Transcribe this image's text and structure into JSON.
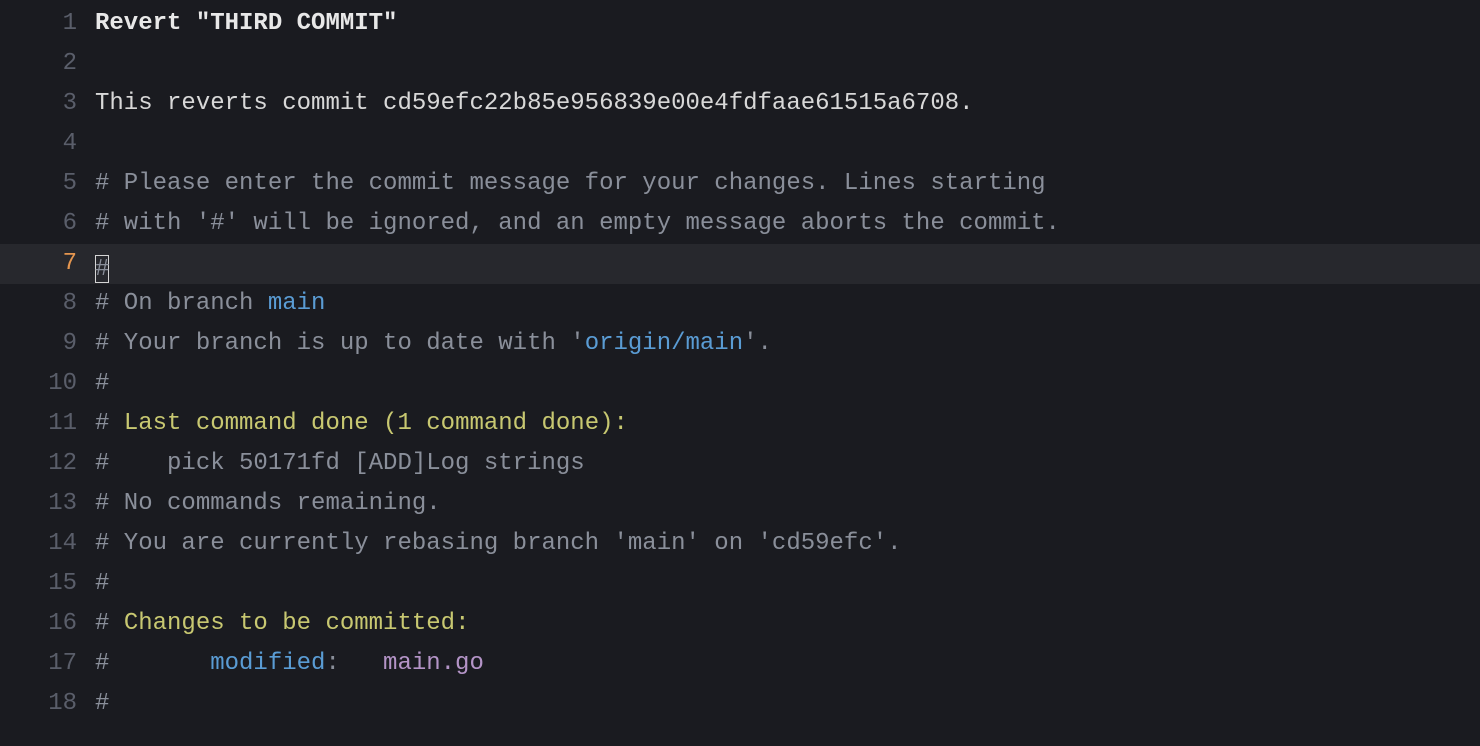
{
  "lines": {
    "l1": {
      "num": "1",
      "subject": "Revert \"THIRD COMMIT\""
    },
    "l2": {
      "num": "2",
      "text": ""
    },
    "l3": {
      "num": "3",
      "text": "This reverts commit cd59efc22b85e956839e00e4fdfaae61515a6708."
    },
    "l4": {
      "num": "4",
      "text": ""
    },
    "l5": {
      "num": "5",
      "text": "# Please enter the commit message for your changes. Lines starting"
    },
    "l6": {
      "num": "6",
      "text": "# with '#' will be ignored, and an empty message aborts the commit."
    },
    "l7": {
      "num": "7",
      "text": ""
    },
    "l8": {
      "num": "8",
      "prefix": "# On branch ",
      "branch": "main"
    },
    "l9": {
      "num": "9",
      "prefix": "# Your branch is up to date with '",
      "branch": "origin/main",
      "suffix": "'."
    },
    "l10": {
      "num": "10",
      "text": "#"
    },
    "l11": {
      "num": "11",
      "prefix": "# ",
      "header": "Last command done (1 command done):"
    },
    "l12": {
      "num": "12",
      "text": "#    pick 50171fd [ADD]Log strings"
    },
    "l13": {
      "num": "13",
      "text": "# No commands remaining."
    },
    "l14": {
      "num": "14",
      "text": "# You are currently rebasing branch 'main' on 'cd59efc'."
    },
    "l15": {
      "num": "15",
      "text": "#"
    },
    "l16": {
      "num": "16",
      "prefix": "# ",
      "header": "Changes to be committed:"
    },
    "l17": {
      "num": "17",
      "prefix": "#       ",
      "kw": "modified",
      "sep": ":   ",
      "file": "main.go"
    },
    "l18": {
      "num": "18",
      "text": "#"
    }
  }
}
